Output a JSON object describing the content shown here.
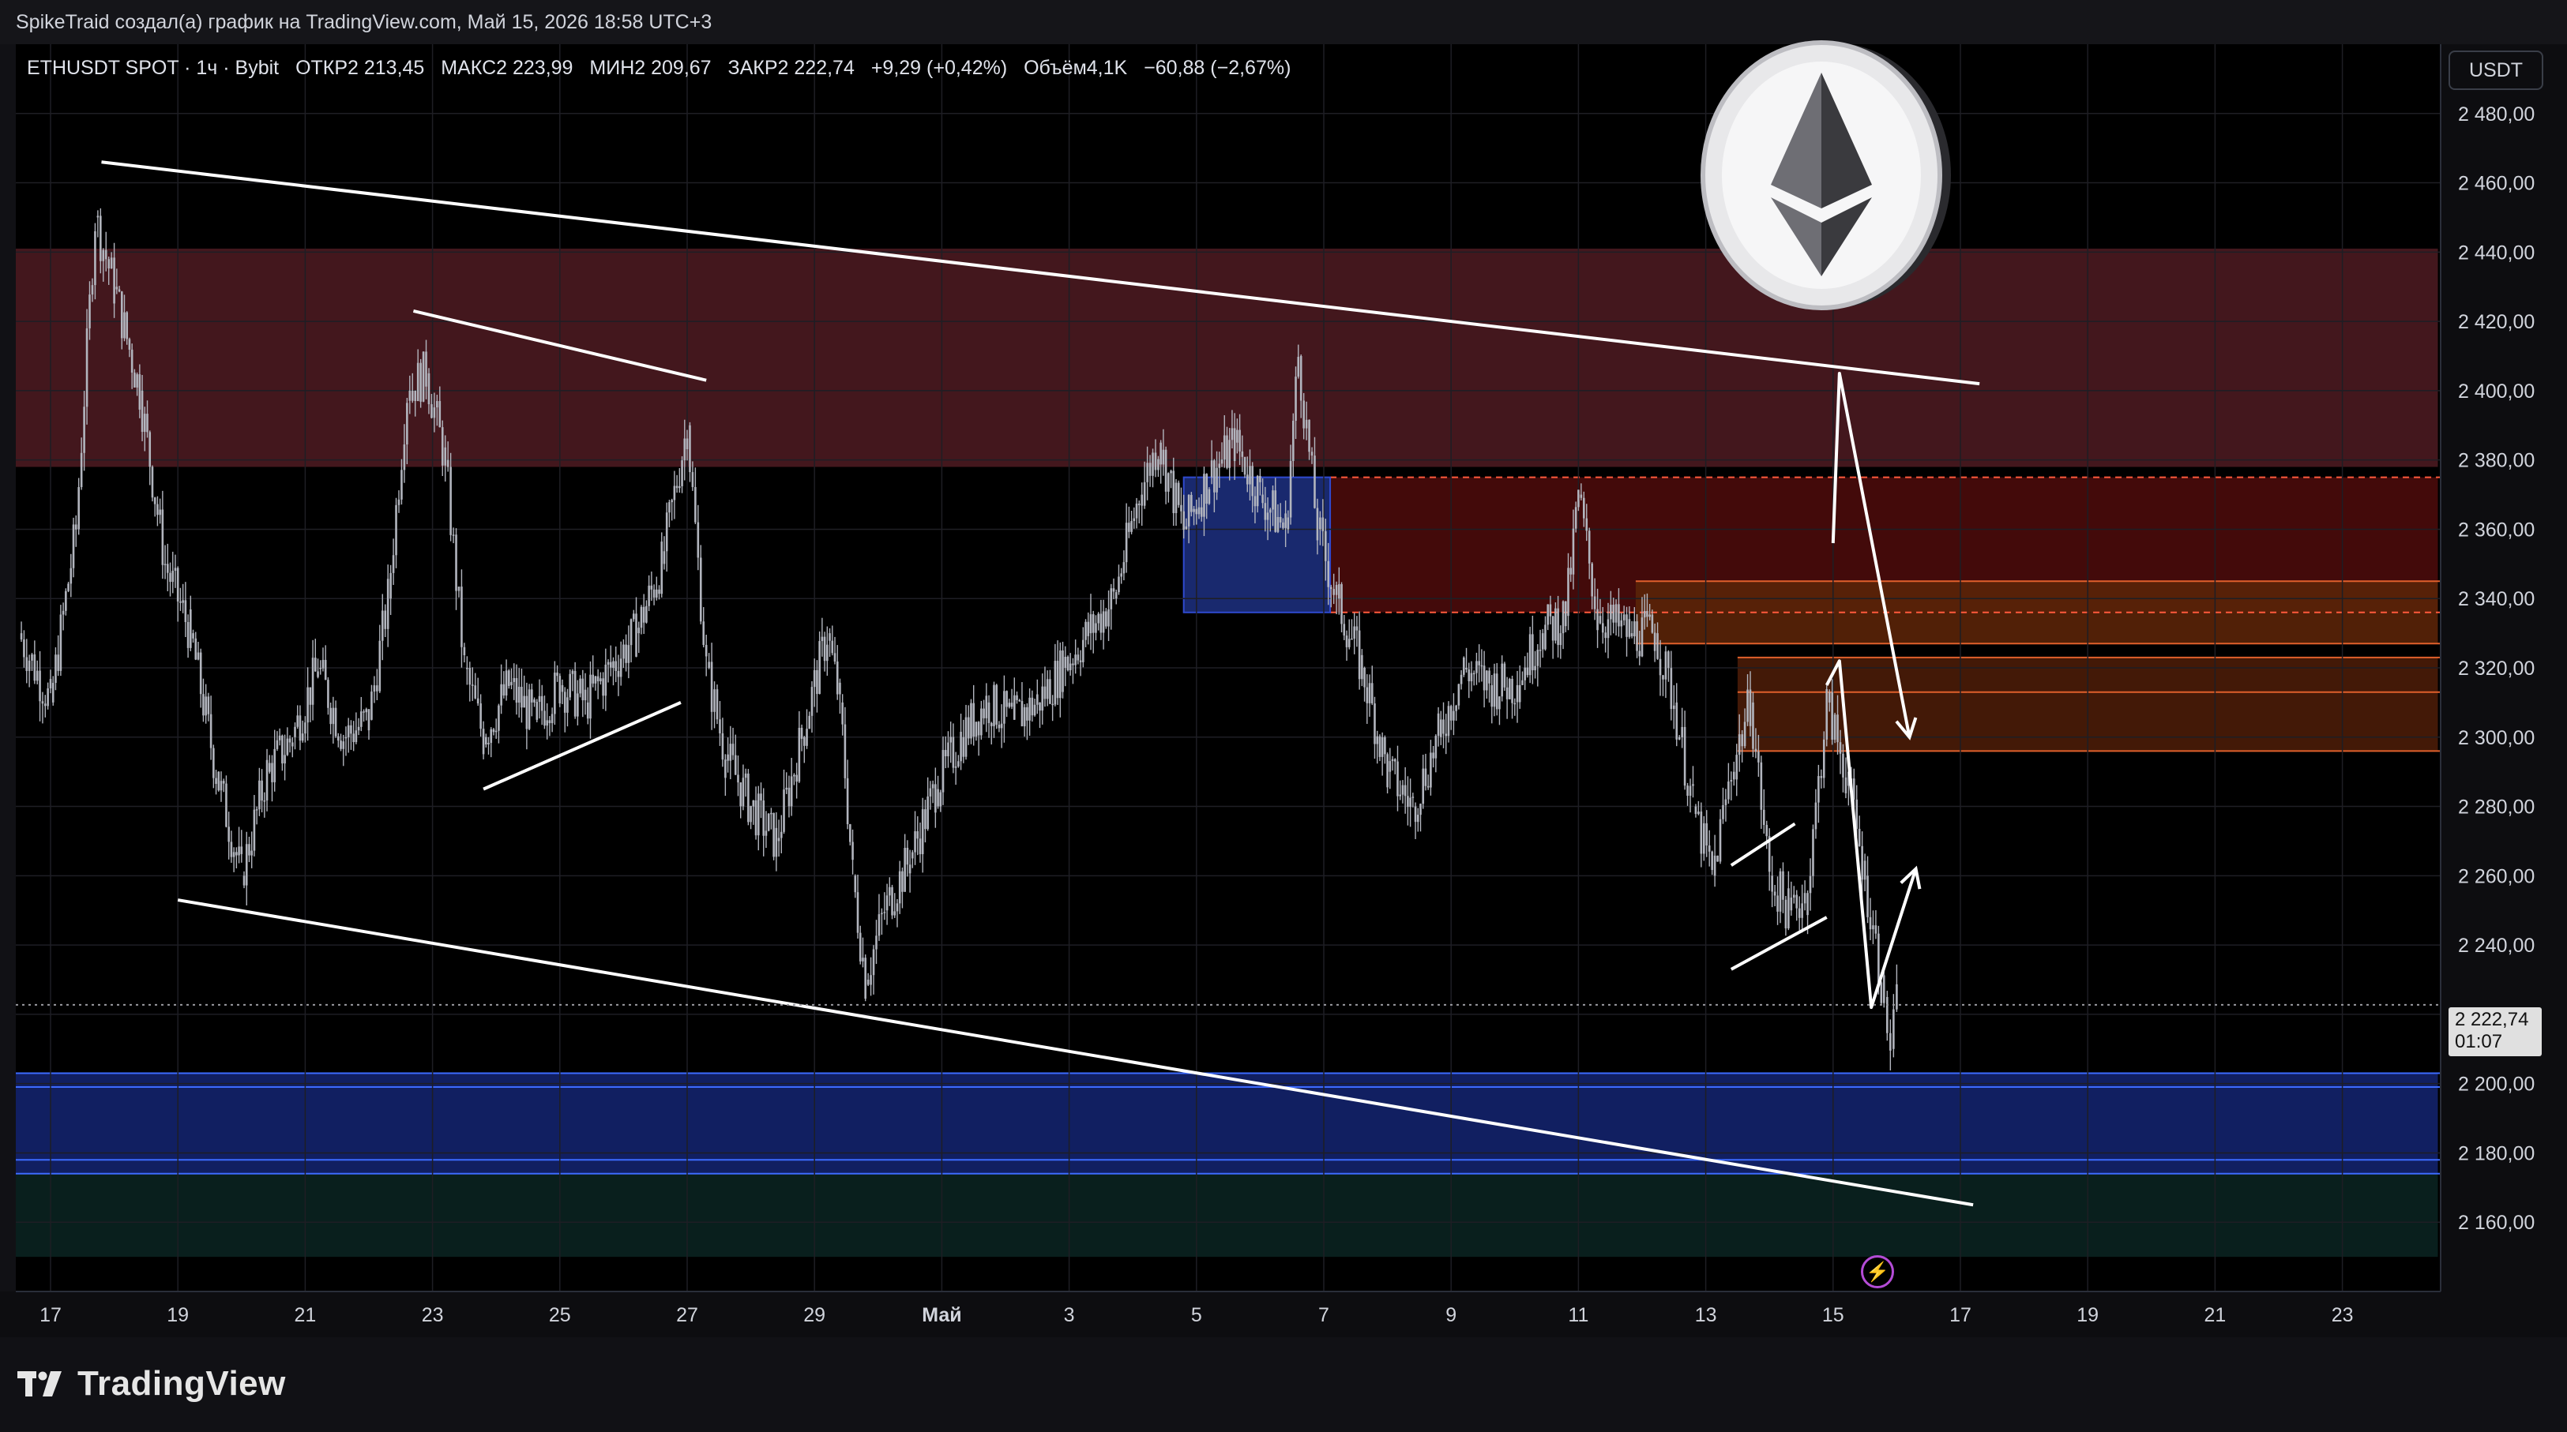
{
  "header": {
    "text": "SpikeTraid создал(а) график на TradingView.com, Май 15, 2026 18:58 UTC+3"
  },
  "legend": {
    "symbol": "ETHUSDT SPOT · 1ч · Bybit",
    "open": "ОТКР2 213,45",
    "high": "МАКС2 223,99",
    "low": "МИН2 209,67",
    "close": "ЗАКР2 222,74",
    "change": "+9,29 (+0,42%)",
    "volume": "Объём4,1K",
    "volume_change": "−60,88 (−2,67%)"
  },
  "currency_button": "USDT",
  "price_tag": {
    "price": "2 222,74",
    "countdown": "01:07"
  },
  "brand": "TradingView",
  "icons": {
    "logo": "tradingview-logo-icon",
    "coin": "ethereum-coin-icon",
    "bolt": "lightning-bolt-icon"
  },
  "colors": {
    "background": "#000000",
    "candles": "#b2b5be",
    "supply_zone": "#3a1418",
    "demand_zone": "#13226b",
    "accent_red": "#ff5a3c"
  },
  "chart_data": {
    "type": "candlestick",
    "symbol": "ETHUSDT",
    "timeframe": "1h",
    "ylim": [
      2140,
      2500
    ],
    "y_ticks": [
      "2 160,00",
      "2 180,00",
      "2 200,00",
      "2 220,00",
      "2 240,00",
      "2 260,00",
      "2 280,00",
      "2 300,00",
      "2 320,00",
      "2 340,00",
      "2 360,00",
      "2 380,00",
      "2 400,00",
      "2 420,00",
      "2 440,00",
      "2 460,00",
      "2 480,00"
    ],
    "y_tick_values": [
      2160,
      2180,
      2200,
      2220,
      2240,
      2260,
      2280,
      2300,
      2320,
      2340,
      2360,
      2380,
      2400,
      2420,
      2440,
      2460,
      2480
    ],
    "x_ticks": [
      {
        "label": "17",
        "day": 17
      },
      {
        "label": "19",
        "day": 19
      },
      {
        "label": "21",
        "day": 21
      },
      {
        "label": "23",
        "day": 23
      },
      {
        "label": "25",
        "day": 25
      },
      {
        "label": "27",
        "day": 27
      },
      {
        "label": "29",
        "day": 29
      },
      {
        "label": "Май",
        "day": 31
      },
      {
        "label": "3",
        "day": 33
      },
      {
        "label": "5",
        "day": 35
      },
      {
        "label": "7",
        "day": 37
      },
      {
        "label": "9",
        "day": 39
      },
      {
        "label": "11",
        "day": 41
      },
      {
        "label": "13",
        "day": 43
      },
      {
        "label": "15",
        "day": 45
      },
      {
        "label": "17",
        "day": 47
      },
      {
        "label": "19",
        "day": 49
      },
      {
        "label": "21",
        "day": 51
      },
      {
        "label": "23",
        "day": 53
      }
    ],
    "price_path": [
      [
        16.5,
        2330
      ],
      [
        17.0,
        2310
      ],
      [
        17.4,
        2360
      ],
      [
        17.7,
        2450
      ],
      [
        18.0,
        2430
      ],
      [
        18.4,
        2400
      ],
      [
        18.8,
        2350
      ],
      [
        19.2,
        2330
      ],
      [
        19.6,
        2290
      ],
      [
        20.0,
        2260
      ],
      [
        20.4,
        2290
      ],
      [
        20.8,
        2300
      ],
      [
        21.2,
        2320
      ],
      [
        21.6,
        2300
      ],
      [
        22.0,
        2305
      ],
      [
        22.3,
        2340
      ],
      [
        22.6,
        2400
      ],
      [
        22.9,
        2405
      ],
      [
        23.2,
        2380
      ],
      [
        23.5,
        2320
      ],
      [
        23.8,
        2300
      ],
      [
        24.2,
        2315
      ],
      [
        24.6,
        2305
      ],
      [
        25.0,
        2315
      ],
      [
        25.4,
        2310
      ],
      [
        25.8,
        2320
      ],
      [
        26.2,
        2330
      ],
      [
        26.6,
        2350
      ],
      [
        27.0,
        2390
      ],
      [
        27.3,
        2320
      ],
      [
        27.6,
        2295
      ],
      [
        28.0,
        2280
      ],
      [
        28.4,
        2270
      ],
      [
        28.8,
        2300
      ],
      [
        29.2,
        2330
      ],
      [
        29.4,
        2310
      ],
      [
        29.6,
        2260
      ],
      [
        29.8,
        2230
      ],
      [
        30.1,
        2250
      ],
      [
        30.5,
        2265
      ],
      [
        30.9,
        2285
      ],
      [
        31.3,
        2300
      ],
      [
        31.7,
        2310
      ],
      [
        32.1,
        2305
      ],
      [
        32.5,
        2310
      ],
      [
        32.9,
        2320
      ],
      [
        33.3,
        2330
      ],
      [
        33.7,
        2340
      ],
      [
        34.1,
        2370
      ],
      [
        34.4,
        2385
      ],
      [
        34.8,
        2360
      ],
      [
        35.2,
        2375
      ],
      [
        35.6,
        2385
      ],
      [
        36.0,
        2370
      ],
      [
        36.4,
        2360
      ],
      [
        36.6,
        2410
      ],
      [
        36.9,
        2360
      ],
      [
        37.2,
        2340
      ],
      [
        37.6,
        2320
      ],
      [
        38.0,
        2290
      ],
      [
        38.4,
        2280
      ],
      [
        38.8,
        2300
      ],
      [
        39.2,
        2320
      ],
      [
        39.6,
        2315
      ],
      [
        40.0,
        2315
      ],
      [
        40.4,
        2330
      ],
      [
        40.8,
        2335
      ],
      [
        41.0,
        2370
      ],
      [
        41.3,
        2335
      ],
      [
        41.8,
        2330
      ],
      [
        42.2,
        2330
      ],
      [
        42.5,
        2310
      ],
      [
        42.8,
        2280
      ],
      [
        43.1,
        2260
      ],
      [
        43.4,
        2290
      ],
      [
        43.7,
        2310
      ],
      [
        44.0,
        2260
      ],
      [
        44.3,
        2250
      ],
      [
        44.6,
        2255
      ],
      [
        44.9,
        2310
      ],
      [
        45.2,
        2290
      ],
      [
        45.5,
        2260
      ],
      [
        45.8,
        2225
      ],
      [
        45.9,
        2210
      ],
      [
        46.0,
        2222
      ]
    ],
    "zones": [
      {
        "label": "supply-zone-top",
        "from_day": 16.0,
        "to_day": 54.5,
        "low": 2378,
        "high": 2441,
        "color": "#4a1a20"
      },
      {
        "label": "supply-zone-mid",
        "from_day": 37.1,
        "to_day": 54.5,
        "low": 2336,
        "high": 2375,
        "color": "#4a0b0b"
      },
      {
        "label": "orange-zone-1",
        "from_day": 41.9,
        "to_day": 54.5,
        "low": 2327,
        "high": 2345,
        "color": "#5a2408"
      },
      {
        "label": "orange-zone-2",
        "from_day": 43.5,
        "to_day": 54.5,
        "low": 2296,
        "high": 2323,
        "color": "#4a1c08"
      },
      {
        "label": "blue-box",
        "from_day": 34.8,
        "to_day": 37.1,
        "low": 2336,
        "high": 2375,
        "color": "#1c2e7a"
      },
      {
        "label": "demand-zone",
        "from_day": 16.0,
        "to_day": 54.5,
        "low": 2174,
        "high": 2203,
        "color": "#13226b"
      },
      {
        "label": "green-zone",
        "from_day": 16.0,
        "to_day": 54.5,
        "low": 2150,
        "high": 2174,
        "color": "#0a2220"
      }
    ],
    "trendlines": [
      [
        [
          17.8,
          2466
        ],
        [
          47.3,
          2402
        ]
      ],
      [
        [
          19.0,
          2253
        ],
        [
          47.2,
          2165
        ]
      ],
      [
        [
          22.7,
          2423
        ],
        [
          27.3,
          2403
        ]
      ],
      [
        [
          23.8,
          2285
        ],
        [
          26.9,
          2310
        ]
      ],
      [
        [
          43.4,
          2233
        ],
        [
          44.9,
          2248
        ]
      ],
      [
        [
          43.4,
          2263
        ],
        [
          44.4,
          2275
        ]
      ]
    ],
    "arrows": [
      [
        [
          45.0,
          2356
        ],
        [
          45.1,
          2405
        ],
        [
          46.2,
          2300
        ]
      ],
      [
        [
          44.9,
          2315
        ],
        [
          45.1,
          2322
        ],
        [
          45.6,
          2222
        ],
        [
          46.3,
          2262
        ]
      ]
    ],
    "last_price": 2222.74,
    "grid": true
  }
}
